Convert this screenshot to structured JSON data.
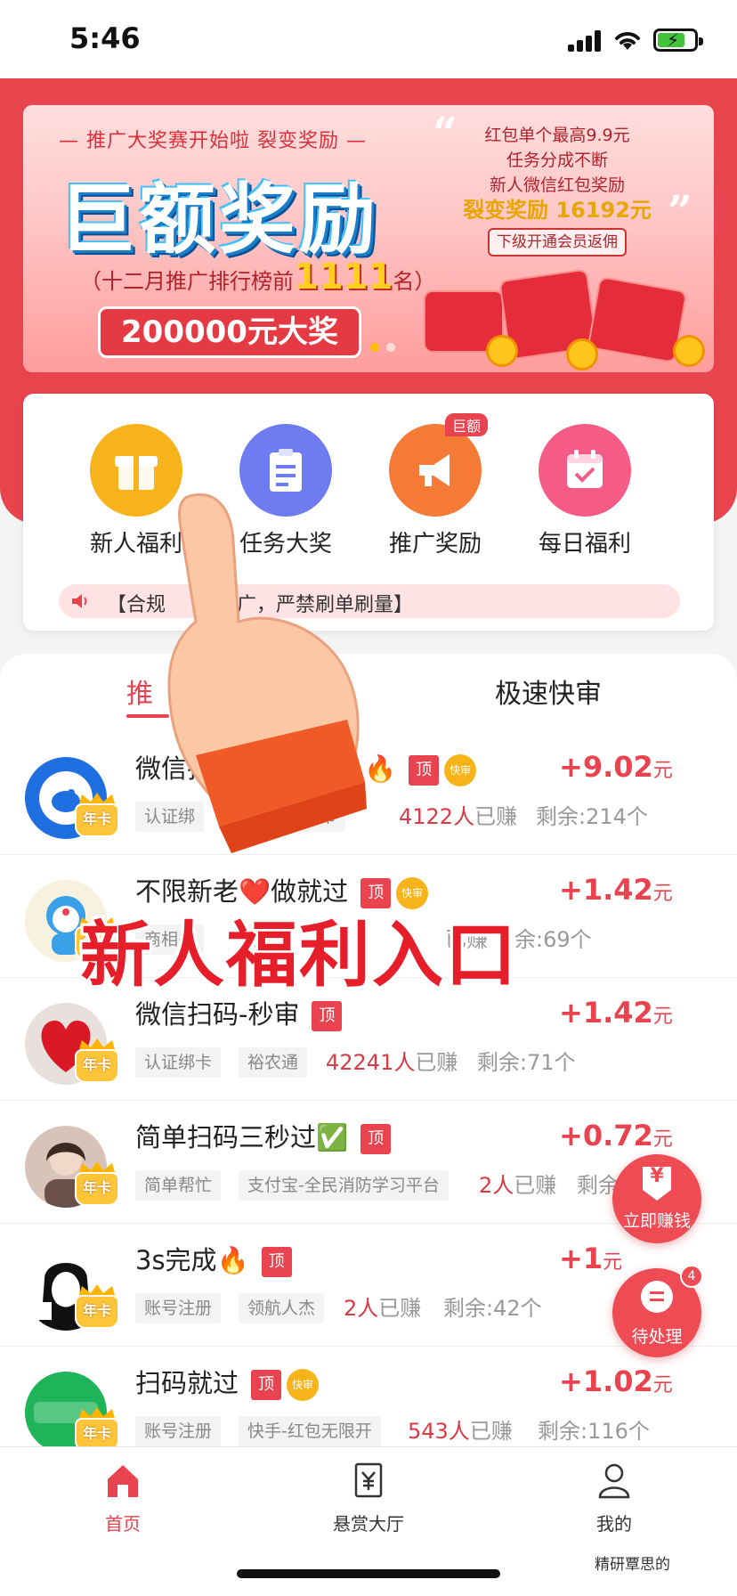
{
  "status_bar": {
    "time": "5:46"
  },
  "banner": {
    "top_line": "— 推广大奖赛开始啦 裂变奖励 —",
    "headline": "巨额奖励",
    "rank_prefix": "（十二月推广排行榜前",
    "rank_number": "1111",
    "rank_suffix": "名）",
    "prize": "200000元大奖",
    "right_lines": [
      "红包单个最高9.9元",
      "任务分成不断",
      "新人微信红包奖励"
    ],
    "right_highlight": "裂变奖励 16192元",
    "right_button": "下级开通会员返佣"
  },
  "nav": [
    {
      "label": "新人福利",
      "icon": "gift-icon",
      "color": "#f7b21c"
    },
    {
      "label": "任务大奖",
      "icon": "clipboard-icon",
      "color": "#6f7bf0"
    },
    {
      "label": "推广奖励",
      "icon": "megaphone-icon",
      "color": "#f57a36",
      "badge": "巨额"
    },
    {
      "label": "每日福利",
      "icon": "calendar-icon",
      "color": "#f45b86"
    }
  ],
  "notice": {
    "text": "【合规 　　　 广，严禁刷单刷量】"
  },
  "tabs": [
    {
      "label": "推"
    },
    {
      "label": "极速快审"
    }
  ],
  "tasks": [
    {
      "title": "微信扫",
      "emoji": "🔥",
      "top": "顶",
      "fast": "快审",
      "tags": [
        "认证绑",
        "民币"
      ],
      "earned_num": "4122人",
      "earned_text": "已赚",
      "remain": "剩余:214个",
      "reward": "+9.02",
      "unit": "元"
    },
    {
      "title": "不限新老❤️做就过",
      "top": "顶",
      "fast": "快审",
      "tags": [
        "商相关",
        "掌上"
      ],
      "earned_num": "",
      "earned_text": "已赚",
      "remain": "余:69个",
      "reward": "+1.42",
      "unit": "元"
    },
    {
      "title": "微信扫码-秒审",
      "top": "顶",
      "tags": [
        "认证绑卡",
        "裕农通"
      ],
      "earned_num": "42241人",
      "earned_text": "已赚",
      "remain": "剩余:71个",
      "reward": "+1.42",
      "unit": "元"
    },
    {
      "title": "简单扫码三秒过✅",
      "top": "顶",
      "tags": [
        "简单帮忙",
        "支付宝-全民消防学习平台"
      ],
      "earned_num": "2人",
      "earned_text": "已赚",
      "remain": "剩余",
      "reward": "+0.72",
      "unit": "元"
    },
    {
      "title": "3s完成🔥",
      "top": "顶",
      "tags": [
        "账号注册",
        "领航人杰"
      ],
      "earned_num": "2人",
      "earned_text": "已赚",
      "remain": "剩余:42个",
      "reward": "+1",
      "unit": "元"
    },
    {
      "title": "扫码就过",
      "top": "顶",
      "fast": "快审",
      "tags": [
        "账号注册",
        "快手-红包无限开"
      ],
      "earned_num": "543人",
      "earned_text": "已赚",
      "remain": "剩余:116个",
      "reward": "+1.02",
      "unit": "元"
    }
  ],
  "year_badge": "年卡",
  "float_buttons": {
    "earn": {
      "label": "立即赚钱",
      "icon_text": "¥"
    },
    "pending": {
      "label": "待处理",
      "count": "4"
    }
  },
  "overlay": {
    "caption": "新人福利入口"
  },
  "tabbar": [
    {
      "label": "首页",
      "icon": "home-icon",
      "active": true
    },
    {
      "label": "悬赏大厅",
      "icon": "yen-note-icon"
    },
    {
      "label": "我的",
      "icon": "person-icon"
    }
  ],
  "watermark": "精研覃思的",
  "colors": {
    "brand": "#e8434e",
    "reward": "#e8434e"
  }
}
